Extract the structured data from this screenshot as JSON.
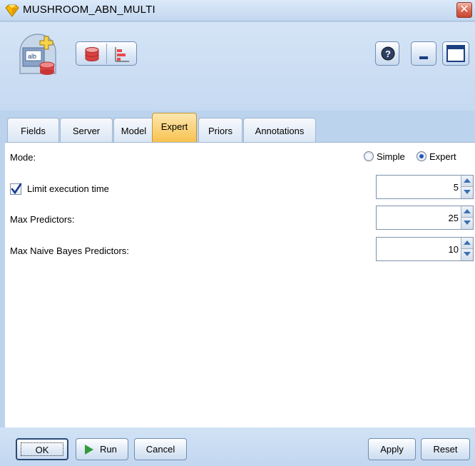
{
  "window": {
    "title": "MUSHROOM_ABN_MULTI",
    "close_label": "✕"
  },
  "toolbar": {
    "help_label": "?"
  },
  "tabs": [
    {
      "label": "Fields"
    },
    {
      "label": "Server"
    },
    {
      "label": "Model"
    },
    {
      "label": "Expert",
      "active": true
    },
    {
      "label": "Priors"
    },
    {
      "label": "Annotations"
    }
  ],
  "expert": {
    "mode_label": "Mode:",
    "mode_options": [
      {
        "label": "Simple",
        "selected": false
      },
      {
        "label": "Expert",
        "selected": true
      }
    ],
    "limit_execution_time": {
      "label": "Limit execution time",
      "checked": true,
      "value": "5"
    },
    "max_predictors": {
      "label": "Max Predictors:",
      "value": "25"
    },
    "max_naive_bayes_predictors": {
      "label": "Max Naive Bayes Predictors:",
      "value": "10"
    }
  },
  "buttons": {
    "ok": "OK",
    "run": "Run",
    "cancel": "Cancel",
    "apply": "Apply",
    "reset": "Reset"
  },
  "colors": {
    "active_tab": "#f8c24f",
    "chrome": "#c5d9f1",
    "run_icon": "#2f9b3a"
  }
}
